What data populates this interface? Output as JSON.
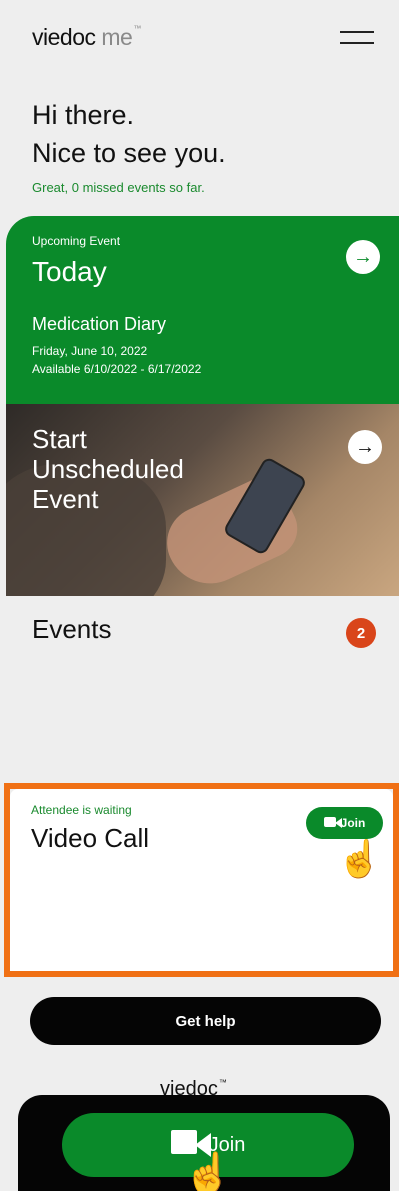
{
  "header": {
    "logo_bold": "viedoc",
    "logo_light": " me",
    "logo_tm": "™",
    "menu_icon": "hamburger-menu-icon"
  },
  "greeting": {
    "line1": "Hi there.",
    "line2": "Nice to see you.",
    "missed": "Great, 0 missed events so far."
  },
  "today_card": {
    "eyebrow": "Upcoming Event",
    "title": "Today",
    "event_name": "Medication Diary",
    "date": "Friday, June 10, 2022",
    "available": "Available 6/10/2022 - 6/17/2022",
    "arrow": "→",
    "color": "#0a8a2a"
  },
  "unscheduled_card": {
    "title": "Start\nUnscheduled\nEvent",
    "arrow": "→"
  },
  "events": {
    "label": "Events",
    "badge": "2",
    "badge_color": "#d9451a"
  },
  "video_call": {
    "eyebrow": "Attendee is waiting",
    "title": "Video Call",
    "join_label": "Join",
    "highlight_color": "#f07014"
  },
  "help": {
    "label": "Get help"
  },
  "footer": {
    "logo": "viedoc",
    "logo_tm": "™"
  },
  "join_bar": {
    "label": "Join"
  },
  "cursor": "☝"
}
